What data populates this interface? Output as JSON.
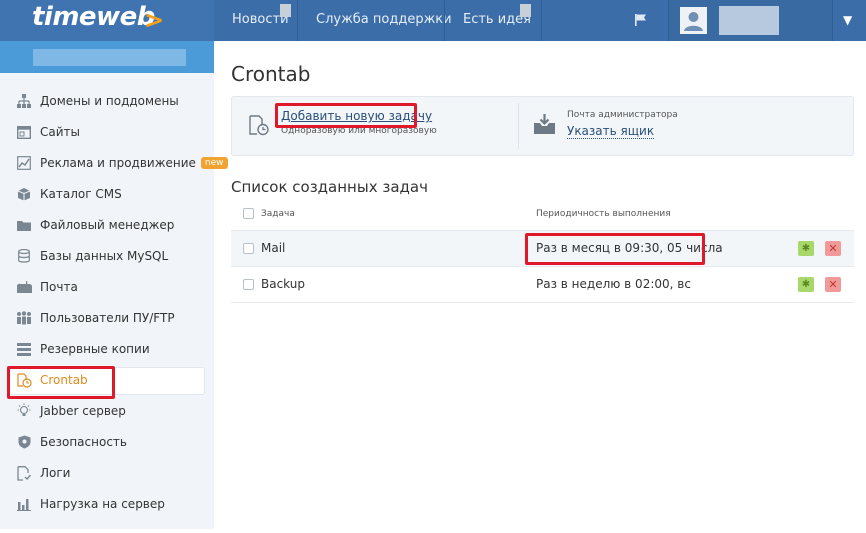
{
  "header": {
    "logo_text": "timeweb",
    "logo_arrow": ">",
    "nav": [
      "Новости",
      "Служба поддержки",
      "Есть идея"
    ],
    "menu_caret": "▼",
    "icons": {
      "flag": "flag-icon",
      "avatar": "user-avatar-icon"
    }
  },
  "sidebar": {
    "items": [
      {
        "label": "Домены и поддомены",
        "icon": "sitemap-icon"
      },
      {
        "label": "Сайты",
        "icon": "browser-window-icon"
      },
      {
        "label": "Реклама и продвижение",
        "icon": "trend-chart-icon",
        "badge": "new"
      },
      {
        "label": "Каталог CMS",
        "icon": "box-icon"
      },
      {
        "label": "Файловый менеджер",
        "icon": "folder-icon"
      },
      {
        "label": "Базы данных MySQL",
        "icon": "database-icon"
      },
      {
        "label": "Почта",
        "icon": "mailbox-icon"
      },
      {
        "label": "Пользователи ПУ/FTP",
        "icon": "users-icon"
      },
      {
        "label": "Резервные копии",
        "icon": "backup-stack-icon"
      },
      {
        "label": "Crontab",
        "icon": "clock-doc-icon",
        "active": true
      },
      {
        "label": "Jabber сервер",
        "icon": "bulb-icon"
      },
      {
        "label": "Безопасность",
        "icon": "shield-icon"
      },
      {
        "label": "Логи",
        "icon": "log-doc-icon"
      },
      {
        "label": "Нагрузка на сервер",
        "icon": "bar-chart-icon"
      }
    ]
  },
  "main": {
    "title": "Crontab",
    "add_task": {
      "link": "Добавить новую задачу",
      "subtitle": "Одноразовую или многоразовую",
      "icon": "clock-doc-icon"
    },
    "admin_mail": {
      "label": "Почта администратора",
      "link": "Указать ящик",
      "icon": "inbox-download-icon"
    },
    "list_title": "Список созданных задач",
    "table": {
      "headers": {
        "task": "Задача",
        "period": "Периодичность выполнения"
      },
      "rows": [
        {
          "name": "Mail",
          "period": "Раз в месяц в 09:30, 05 числа"
        },
        {
          "name": "Backup",
          "period": "Раз в неделю в 02:00, вс"
        }
      ],
      "gear_glyph": "✱",
      "delete_glyph": "✕"
    }
  },
  "colors": {
    "topbar": "#3b6ea8",
    "accent_orange": "#f7a11a",
    "sidebar_bg": "#f1f5f9",
    "highlight_red": "#e0192a",
    "active_item": "#e08a1e"
  }
}
